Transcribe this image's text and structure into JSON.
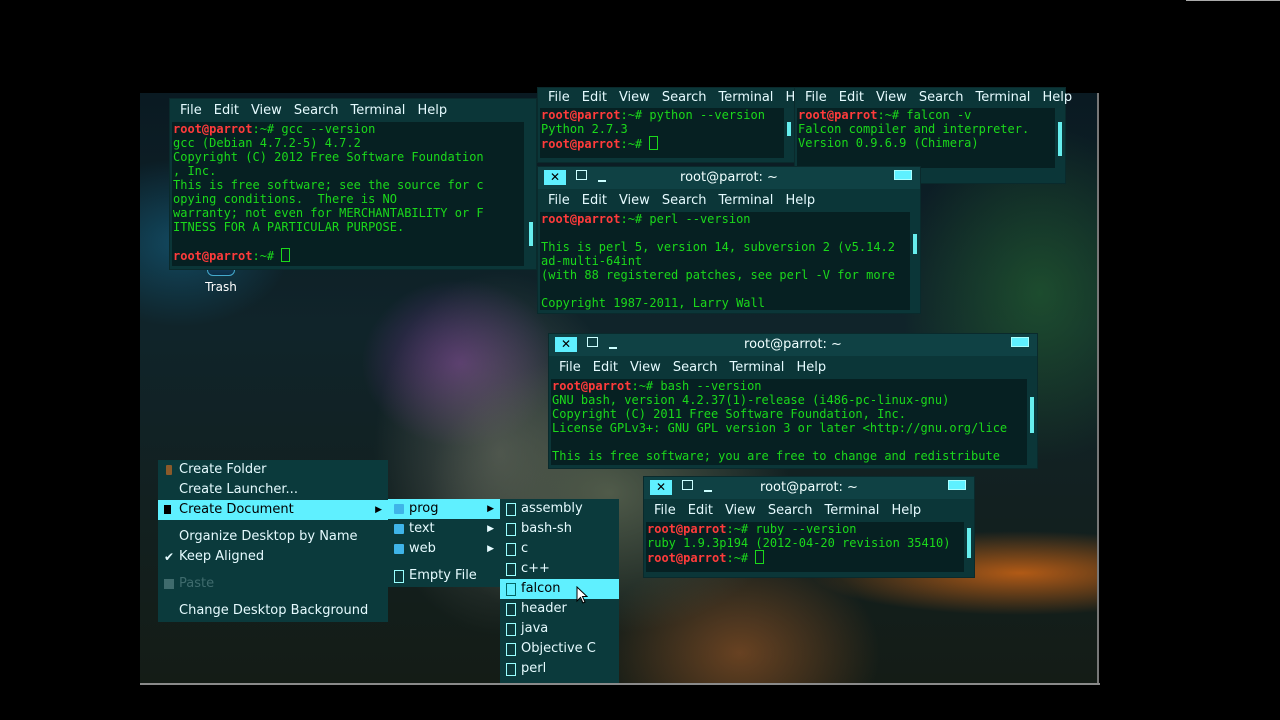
{
  "desktop": {
    "trash_label": "Trash"
  },
  "menus": [
    "File",
    "Edit",
    "View",
    "Search",
    "Terminal",
    "Help"
  ],
  "terminals": {
    "gcc": {
      "title": "",
      "lines": [
        {
          "prompt": "root@parrot",
          "rest": ":~# gcc --version"
        },
        {
          "text": "gcc (Debian 4.7.2-5) 4.7.2"
        },
        {
          "text": "Copyright (C) 2012 Free Software Foundation"
        },
        {
          "text": ", Inc."
        },
        {
          "text": "This is free software; see the source for c"
        },
        {
          "text": "opying conditions.  There is NO"
        },
        {
          "text": "warranty; not even for MERCHANTABILITY or F"
        },
        {
          "text": "ITNESS FOR A PARTICULAR PURPOSE."
        },
        {
          "text": ""
        },
        {
          "prompt": "root@parrot",
          "rest": ":~# ",
          "cursor": true
        }
      ]
    },
    "python": {
      "lines": [
        {
          "prompt": "root@parrot",
          "rest": ":~# python --version"
        },
        {
          "text": "Python 2.7.3"
        },
        {
          "prompt": "root@parrot",
          "rest": ":~# ",
          "cursor": true
        }
      ]
    },
    "falcon": {
      "lines": [
        {
          "prompt": "root@parrot",
          "rest": ":~# falcon -v"
        },
        {
          "text": "Falcon compiler and interpreter."
        },
        {
          "text": "Version 0.9.6.9 (Chimera)"
        }
      ]
    },
    "perl": {
      "title": "root@parrot: ~",
      "lines": [
        {
          "prompt": "root@parrot",
          "rest": ":~# perl --version"
        },
        {
          "text": ""
        },
        {
          "text": "This is perl 5, version 14, subversion 2 (v5.14.2"
        },
        {
          "text": "ad-multi-64int"
        },
        {
          "text": "(with 88 registered patches, see perl -V for more"
        },
        {
          "text": ""
        },
        {
          "text": "Copyright 1987-2011, Larry Wall"
        }
      ]
    },
    "bash": {
      "title": "root@parrot: ~",
      "lines": [
        {
          "prompt": "root@parrot",
          "rest": ":~# bash --version"
        },
        {
          "text": "GNU bash, version 4.2.37(1)-release (i486-pc-linux-gnu)"
        },
        {
          "text": "Copyright (C) 2011 Free Software Foundation, Inc."
        },
        {
          "text": "License GPLv3+: GNU GPL version 3 or later <http://gnu.org/lice"
        },
        {
          "text": ""
        },
        {
          "text": "This is free software; you are free to change and redistribute"
        }
      ]
    },
    "ruby": {
      "title": "root@parrot: ~",
      "lines": [
        {
          "prompt": "root@parrot",
          "rest": ":~# ruby --version"
        },
        {
          "text": "ruby 1.9.3p194 (2012-04-20 revision 35410)"
        },
        {
          "prompt": "root@parrot",
          "rest": ":~# ",
          "cursor": true
        }
      ]
    }
  },
  "context_menu": {
    "create_folder": "Create Folder",
    "create_launcher": "Create Launcher...",
    "create_document": "Create Document",
    "organize": "Organize Desktop by Name",
    "keep_aligned": "Keep Aligned",
    "paste": "Paste",
    "change_bg": "Change Desktop Background"
  },
  "doc_menu": {
    "prog": "prog",
    "text": "text",
    "web": "web",
    "empty_file": "Empty File"
  },
  "prog_menu": [
    "assembly",
    "bash-sh",
    "c",
    "c++",
    "falcon",
    "header",
    "java",
    "Objective C",
    "perl"
  ],
  "prog_selected": "falcon"
}
